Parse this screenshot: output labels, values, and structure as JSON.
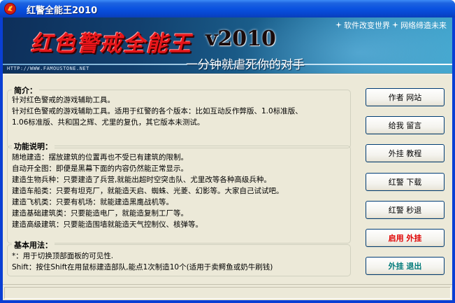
{
  "window": {
    "title": "红警全能王2010"
  },
  "banner": {
    "title": "红色警戒全能王",
    "version": "v2010",
    "slogan": "一分钟就虐死你的对手",
    "tagline_part1": "软件改变世界",
    "tagline_part2": "网络缔造未来",
    "url": "HTTP://WWW.FAMOUSTONE.NET"
  },
  "intro": {
    "heading": "简介：",
    "lines": [
      "针对红色警戒的游戏辅助工具。",
      "针对红色警戒的游戏辅助工具。适用于红警的各个版本：比如互动反作弊版、1.0标准版、",
      "1.06标准版、共和国之辉、尤里的复仇，其它版本未测试。"
    ]
  },
  "features": {
    "heading": "功能说明：",
    "lines": [
      "随地建造：摆放建筑的位置再也不受已有建筑的限制。",
      "自动开全图：即便是黑幕下面的内容仍然能正常显示。",
      "建造生物兵种：只要建造了兵营,就能出超时空突击队、尤里改等各种高级兵种。",
      "建造车船类：只要有坦克厂，就能造天启、蜘蛛、光菱、幻影等。大家自己试试吧。",
      "建造飞机类：只要有机场：就能建造黑鹰战机等。",
      "建造基础建筑类：只要能造电厂，就能造复制工厂等。",
      "建造高级建筑：只要能造围墙就能造天气控制仪、核弹等。"
    ]
  },
  "usage": {
    "heading": "基本用法：",
    "lines": [
      "*：用于切换顶部面板的可见性.",
      "Shift：按住Shift在用鼠标建造部队,能点1次制造10个(适用于卖鳄鱼或奶牛刷钱)"
    ]
  },
  "buttons": {
    "author": "作者  网站",
    "feedback": "给我  留言",
    "tutorial": "外挂  教程",
    "download": "红警  下载",
    "quit_game": "红警  秒退",
    "enable": "启用  外挂",
    "exit": "外挂  退出"
  },
  "colors": {
    "titlebar": "#0a52e0",
    "window_bg": "#ece9d8",
    "banner_title": "#e8161a",
    "enable_button_text": "#e00000",
    "exit_button_text": "#007a7a"
  },
  "icons": {
    "app": "red-alert-logo-icon",
    "tagline": "sparkle-icon"
  }
}
